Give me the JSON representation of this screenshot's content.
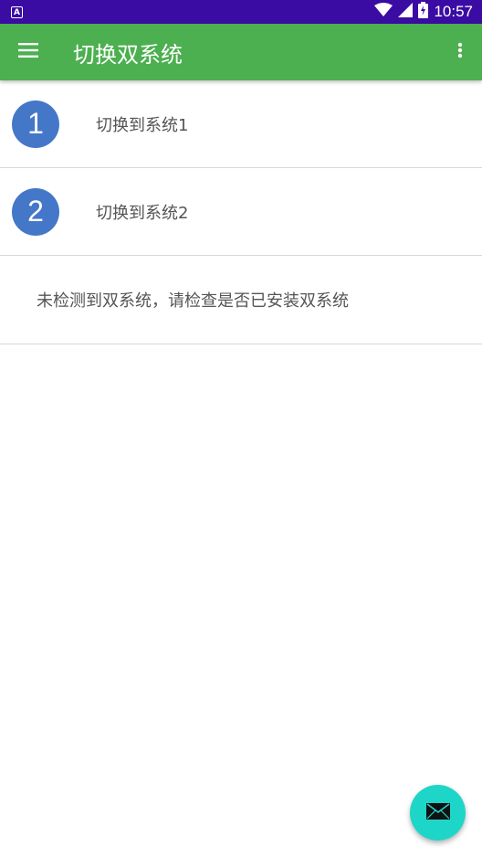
{
  "status_bar": {
    "notification_icon": "A",
    "time": "10:57",
    "icons": [
      "wifi-icon",
      "signal-icon",
      "battery-charging-icon"
    ]
  },
  "app_bar": {
    "title": "切换双系统",
    "menu_icon": "hamburger-menu-icon",
    "overflow_icon": "more-vert-icon",
    "color": "#4caf50"
  },
  "list": {
    "items": [
      {
        "number": "1",
        "label": "切换到系统1"
      },
      {
        "number": "2",
        "label": "切换到系统2"
      }
    ],
    "notice": "未检测到双系统，请检查是否已安装双系统"
  },
  "fab": {
    "icon": "mail-icon",
    "color": "#1ed6c8"
  },
  "colors": {
    "status_bar": "#3a0ca3",
    "badge": "#4577c9"
  }
}
